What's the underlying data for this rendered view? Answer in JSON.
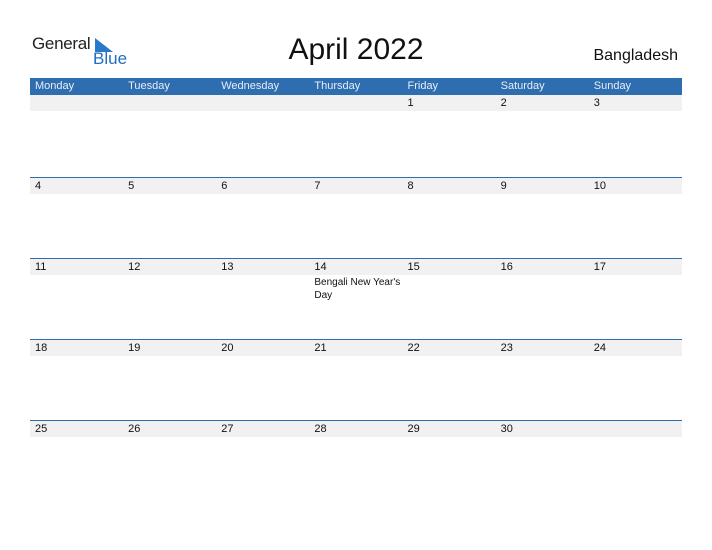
{
  "logo": {
    "general": "General",
    "blue": "Blue"
  },
  "title": "April 2022",
  "country": "Bangladesh",
  "colors": {
    "header_bg": "#2e6eb0",
    "row_strip_bg": "#f1f1f1",
    "logo_blue": "#1f6fbf"
  },
  "weekdays": [
    "Monday",
    "Tuesday",
    "Wednesday",
    "Thursday",
    "Friday",
    "Saturday",
    "Sunday"
  ],
  "weeks": [
    {
      "days": [
        "",
        "",
        "",
        "",
        "1",
        "2",
        "3"
      ],
      "events": [
        "",
        "",
        "",
        "",
        "",
        "",
        ""
      ]
    },
    {
      "days": [
        "4",
        "5",
        "6",
        "7",
        "8",
        "9",
        "10"
      ],
      "events": [
        "",
        "",
        "",
        "",
        "",
        "",
        ""
      ]
    },
    {
      "days": [
        "11",
        "12",
        "13",
        "14",
        "15",
        "16",
        "17"
      ],
      "events": [
        "",
        "",
        "",
        "Bengali New Year's Day",
        "",
        "",
        ""
      ]
    },
    {
      "days": [
        "18",
        "19",
        "20",
        "21",
        "22",
        "23",
        "24"
      ],
      "events": [
        "",
        "",
        "",
        "",
        "",
        "",
        ""
      ]
    },
    {
      "days": [
        "25",
        "26",
        "27",
        "28",
        "29",
        "30",
        ""
      ],
      "events": [
        "",
        "",
        "",
        "",
        "",
        "",
        ""
      ]
    }
  ]
}
